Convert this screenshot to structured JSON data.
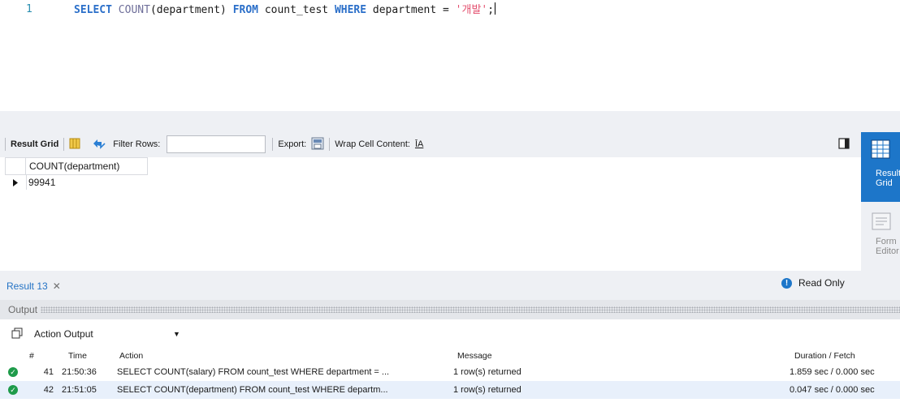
{
  "editor": {
    "line_number": "1",
    "query": {
      "kw_select": "SELECT",
      "fn": "COUNT",
      "arg": "(department)",
      "kw_from": "FROM",
      "table": "count_test",
      "kw_where": "WHERE",
      "col": "department =",
      "value": "'개발'",
      "semicolon": ";"
    }
  },
  "result_toolbar": {
    "result_grid_label": "Result Grid",
    "filter_rows_label": "Filter Rows:",
    "filter_value": "",
    "export_label": "Export:",
    "wrap_label": "Wrap Cell Content:",
    "wrap_icon": "ĪA"
  },
  "grid": {
    "columns": [
      "COUNT(department)"
    ],
    "rows": [
      [
        "99941"
      ]
    ]
  },
  "side_panel": {
    "result_grid": "Result Grid",
    "form_editor": "Form Editor"
  },
  "tabs": {
    "active": "Result 13",
    "read_only": "Read Only"
  },
  "output": {
    "title": "Output",
    "select_value": "Action Output",
    "columns": {
      "num": "#",
      "time": "Time",
      "action": "Action",
      "message": "Message",
      "duration": "Duration / Fetch"
    },
    "rows": [
      {
        "num": "41",
        "time": "21:50:36",
        "action": "SELECT COUNT(salary) FROM count_test WHERE department = ...",
        "message": "1 row(s) returned",
        "duration": "1.859 sec / 0.000 sec",
        "status": "success"
      },
      {
        "num": "42",
        "time": "21:51:05",
        "action": "SELECT COUNT(department) FROM count_test WHERE departm...",
        "message": "1 row(s) returned",
        "duration": "0.047 sec / 0.000 sec",
        "status": "success"
      }
    ]
  },
  "colors": {
    "accent": "#1d76c9",
    "keyword": "#2b6fc9",
    "string": "#e34f6e",
    "success": "#1e9b4a"
  }
}
